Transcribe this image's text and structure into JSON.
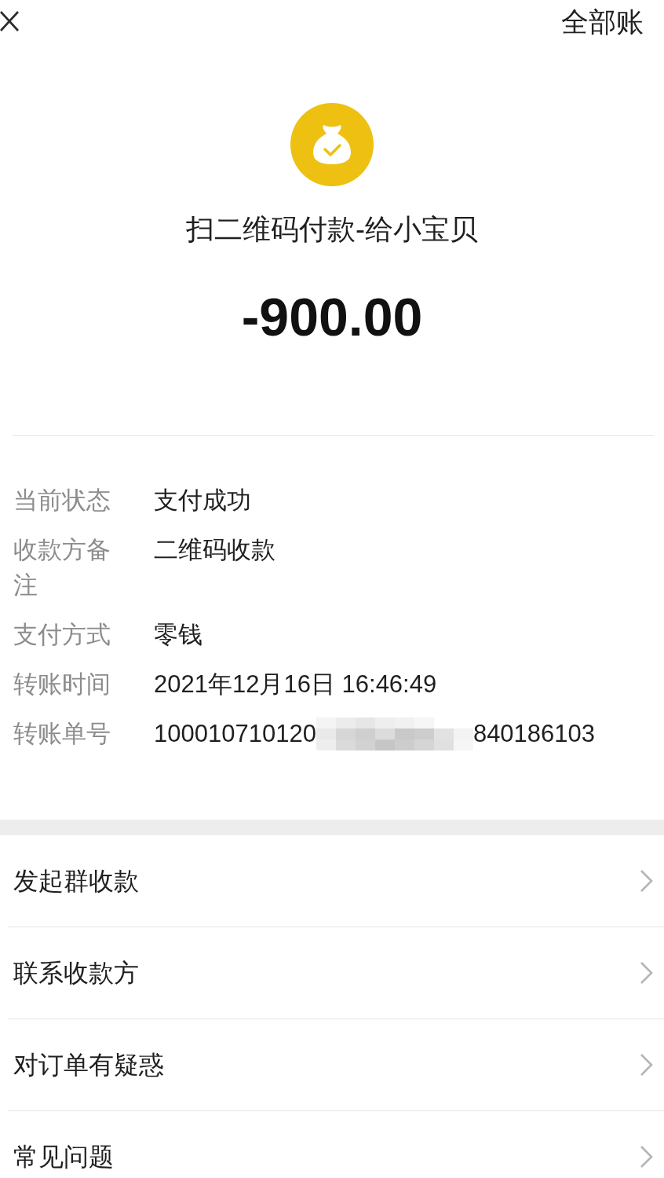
{
  "header": {
    "action_label": "全部账"
  },
  "transaction": {
    "title": "扫二维码付款-给小宝贝",
    "amount": "-900.00"
  },
  "details": [
    {
      "label": "当前状态",
      "value": "支付成功",
      "masked": false
    },
    {
      "label": "收款方备注",
      "value": "二维码收款",
      "masked": false
    },
    {
      "label": "支付方式",
      "value": "零钱",
      "masked": false
    },
    {
      "label": "转账时间",
      "value": "2021年12月16日 16:46:49",
      "masked": false
    },
    {
      "label": "转账单号",
      "value": "100010710120",
      "masked": true,
      "value_end": "840186103"
    }
  ],
  "menu": [
    {
      "label": "发起群收款"
    },
    {
      "label": "联系收款方"
    },
    {
      "label": "对订单有疑惑"
    },
    {
      "label": "常见问题"
    }
  ]
}
